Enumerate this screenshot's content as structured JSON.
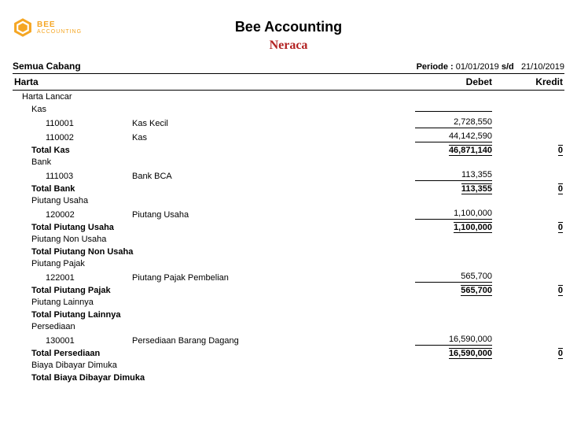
{
  "brand": {
    "line1": "BEE",
    "line2": "ACCOUNTING"
  },
  "title": "Bee Accounting",
  "subtitle": "Neraca",
  "branch": "Semua Cabang",
  "period": {
    "label": "Periode :",
    "from": "01/01/2019",
    "sep": "s/d",
    "to": "21/10/2019"
  },
  "columns": {
    "harta": "Harta",
    "debet": "Debet",
    "kredit": "Kredit"
  },
  "labels": {
    "harta_lancar": "Harta Lancar",
    "kas_hdr": "Kas",
    "kas_kecil_code": "110001",
    "kas_kecil": "Kas Kecil",
    "kas_kecil_val": "2,728,550",
    "kas_code": "110002",
    "kas": "Kas",
    "kas_val": "44,142,590",
    "total_kas": "Total Kas",
    "total_kas_d": "46,871,140",
    "total_kas_k": "0",
    "bank_hdr": "Bank",
    "bank_bca_code": "111003",
    "bank_bca": "Bank BCA",
    "bank_bca_val": "113,355",
    "total_bank": "Total Bank",
    "total_bank_d": "113,355",
    "total_bank_k": "0",
    "piutang_usaha_hdr": "Piutang Usaha",
    "pu_code": "120002",
    "pu_name": "Piutang Usaha",
    "pu_val": "1,100,000",
    "total_pu": "Total Piutang Usaha",
    "total_pu_d": "1,100,000",
    "total_pu_k": "0",
    "pnu_hdr": "Piutang Non Usaha",
    "total_pnu": "Total Piutang Non Usaha",
    "ppajak_hdr": "Piutang Pajak",
    "pp_code": "122001",
    "pp_name": "Piutang Pajak Pembelian",
    "pp_val": "565,700",
    "total_pp": "Total Piutang Pajak",
    "total_pp_d": "565,700",
    "total_pp_k": "0",
    "plain_hdr": "Piutang Lainnya",
    "total_plain": "Total Piutang Lainnya",
    "persediaan_hdr": "Persediaan",
    "pd_code": "130001",
    "pd_name": "Persediaan Barang Dagang",
    "pd_val": "16,590,000",
    "total_pd": "Total Persediaan",
    "total_pd_d": "16,590,000",
    "total_pd_k": "0",
    "bdd_hdr": "Biaya Dibayar Dimuka",
    "total_bdd": "Total Biaya Dibayar Dimuka"
  }
}
